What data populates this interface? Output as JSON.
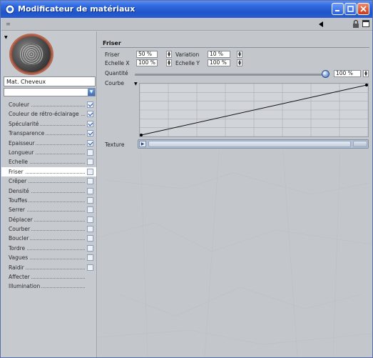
{
  "window": {
    "title": "Modificateur de matériaux",
    "colors": {
      "titlebar": "#2f6ae0",
      "panel": "#c6cacf",
      "accent": "#2150a8",
      "close": "#c83a1c"
    }
  },
  "toolbar": {
    "menu_glyph": "≡",
    "icons": [
      "menu-icon",
      "back-arrow-icon",
      "lock-icon",
      "new-window-icon"
    ]
  },
  "material": {
    "name": "Mat. Cheveux",
    "sub_value": ""
  },
  "channels": [
    {
      "label": "Couleur",
      "checked": true,
      "has_checkbox": true,
      "selected": false
    },
    {
      "label": "Couleur de rétro-éclairage",
      "checked": true,
      "has_checkbox": true,
      "selected": false
    },
    {
      "label": "Spécularité",
      "checked": true,
      "has_checkbox": true,
      "selected": false
    },
    {
      "label": "Transparence",
      "checked": true,
      "has_checkbox": true,
      "selected": false
    },
    {
      "label": "Epaisseur",
      "checked": true,
      "has_checkbox": true,
      "selected": false
    },
    {
      "label": "Longueur",
      "checked": false,
      "has_checkbox": true,
      "selected": false
    },
    {
      "label": "Echelle",
      "checked": false,
      "has_checkbox": true,
      "selected": false
    },
    {
      "label": "Friser",
      "checked": false,
      "has_checkbox": true,
      "selected": true
    },
    {
      "label": "Crêper",
      "checked": false,
      "has_checkbox": true,
      "selected": false
    },
    {
      "label": "Densité",
      "checked": false,
      "has_checkbox": true,
      "selected": false
    },
    {
      "label": "Touffes",
      "checked": false,
      "has_checkbox": true,
      "selected": false
    },
    {
      "label": "Serrer",
      "checked": false,
      "has_checkbox": true,
      "selected": false
    },
    {
      "label": "Déplacer",
      "checked": false,
      "has_checkbox": true,
      "selected": false
    },
    {
      "label": "Courber",
      "checked": false,
      "has_checkbox": true,
      "selected": false
    },
    {
      "label": "Boucler",
      "checked": false,
      "has_checkbox": true,
      "selected": false
    },
    {
      "label": "Tordre",
      "checked": false,
      "has_checkbox": true,
      "selected": false
    },
    {
      "label": "Vagues",
      "checked": false,
      "has_checkbox": true,
      "selected": false
    },
    {
      "label": "Raidir",
      "checked": false,
      "has_checkbox": true,
      "selected": false
    },
    {
      "label": "Affecter",
      "checked": false,
      "has_checkbox": false,
      "selected": false
    },
    {
      "label": "Illumination",
      "checked": false,
      "has_checkbox": false,
      "selected": false
    }
  ],
  "section": {
    "title": "Friser",
    "friser_label": "Friser",
    "friser_value": "50 %",
    "variation_label": "Variation",
    "variation_value": "10 %",
    "echelle_x_label": "Echelle X",
    "echelle_x_value": "100 %",
    "echelle_y_label": "Echelle Y",
    "echelle_y_value": "100 %",
    "quantite_label": "Quantité",
    "quantite_value": "100 %",
    "quantite_level": 1.0,
    "courbe_label": "Courbe",
    "curve_start": [
      0,
      0
    ],
    "curve_end": [
      1,
      1
    ],
    "texture_label": "Texture"
  }
}
